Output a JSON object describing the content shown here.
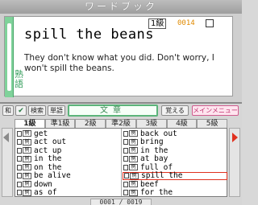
{
  "title": "ワードブック",
  "card": {
    "level": "1級",
    "number": "0014",
    "phrase": "spill the beans",
    "example": "They don't know what you did. Don't worry, I won't spill the beans.",
    "category": "熟語"
  },
  "toolbar": {
    "wa_label": "和",
    "check_icon": "check",
    "search_label": "検索",
    "word_label": "単語",
    "input_text": "文章",
    "memorize_label": "覚える",
    "menu_label": "メインメニュー"
  },
  "tabs": [
    "1級",
    "準1級",
    "2級",
    "準2級",
    "3級",
    "4級",
    "5級"
  ],
  "list": {
    "left": [
      "get",
      "act out",
      "act up",
      "in the",
      "on the",
      "be alive",
      "down",
      "as of"
    ],
    "right": [
      "back out",
      "bring",
      "in the",
      "at bay",
      "full of",
      "spill the",
      "beef",
      "for the"
    ],
    "example_tag": "例"
  },
  "counter": "0001 / 0019",
  "colors": {
    "accent_green": "#7fd29a",
    "number_orange": "#e08a00",
    "menu_pink": "#d05c8f",
    "selection_red": "#e0301e"
  }
}
